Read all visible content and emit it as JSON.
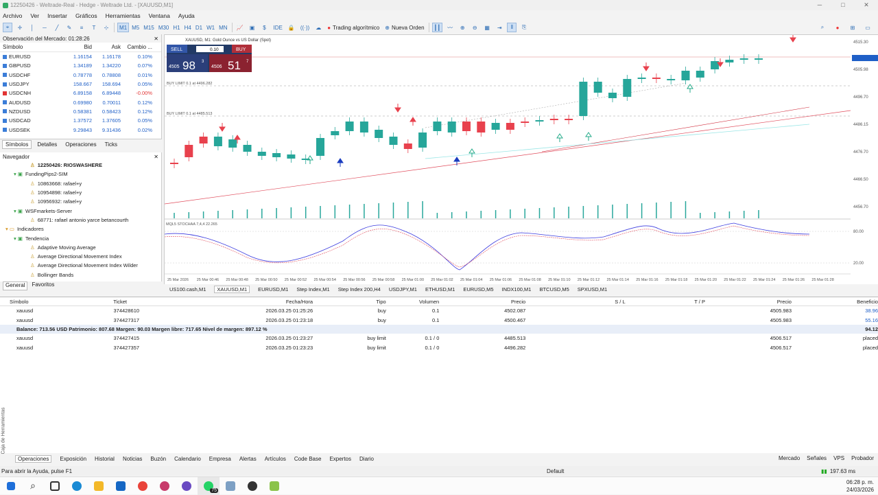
{
  "window": {
    "title": "12250426 - Weltrade-Real - Hedge - Weltrade Ltd. - [XAUUSD,M1]"
  },
  "menu": [
    "Archivo",
    "Ver",
    "Insertar",
    "Gráficos",
    "Herramientas",
    "Ventana",
    "Ayuda"
  ],
  "toolbar": {
    "timeframes": [
      "M1",
      "M5",
      "M15",
      "M30",
      "H1",
      "H4",
      "D1",
      "W1",
      "MN"
    ],
    "algo": "Trading algorítmico",
    "new_order": "Nueva Orden",
    "ide": "IDE"
  },
  "market": {
    "title": "Observación del Mercado: 01:28:26",
    "cols": [
      "Símbolo",
      "Bid",
      "Ask",
      "Cambio ..."
    ],
    "rows": [
      {
        "s": "EURUSD",
        "b": "1.16154",
        "a": "1.16178",
        "c": "0.10%"
      },
      {
        "s": "GBPUSD",
        "b": "1.34189",
        "a": "1.34220",
        "c": "0.07%"
      },
      {
        "s": "USDCHF",
        "b": "0.78778",
        "a": "0.78808",
        "c": "0.01%"
      },
      {
        "s": "USDJPY",
        "b": "158.667",
        "a": "158.694",
        "c": "0.05%"
      },
      {
        "s": "USDCNH",
        "b": "6.89158",
        "a": "6.89448",
        "c": "-0.00%"
      },
      {
        "s": "AUDUSD",
        "b": "0.69980",
        "a": "0.70011",
        "c": "0.12%"
      },
      {
        "s": "NZDUSD",
        "b": "0.58381",
        "a": "0.58423",
        "c": "0.12%"
      },
      {
        "s": "USDCAD",
        "b": "1.37572",
        "a": "1.37605",
        "c": "0.05%"
      },
      {
        "s": "USDSEK",
        "b": "9.29843",
        "a": "9.31436",
        "c": "0.02%"
      }
    ],
    "tabs": [
      "Símbolos",
      "Detalles",
      "Operaciones",
      "Ticks"
    ]
  },
  "navigator": {
    "title": "Navegador",
    "items": [
      {
        "t": "12250426: RIOSWASHERE",
        "lvl": 3,
        "bold": true
      },
      {
        "t": "FundingPips2-SIM",
        "lvl": 1
      },
      {
        "t": "10863668: rafael+y",
        "lvl": 3
      },
      {
        "t": "10954898: rafael+y",
        "lvl": 3
      },
      {
        "t": "10956932: rafael+y",
        "lvl": 3
      },
      {
        "t": "WSFmarkets-Server",
        "lvl": 1
      },
      {
        "t": "68771: rafael antonio yarce betancourth",
        "lvl": 3
      },
      {
        "t": "Indicadores",
        "lvl": 0
      },
      {
        "t": "Tendencia",
        "lvl": 1
      },
      {
        "t": "Adaptive Moving Average",
        "lvl": 3
      },
      {
        "t": "Average Directional Movement Index",
        "lvl": 3
      },
      {
        "t": "Average Directional Movement Index Wilder",
        "lvl": 3
      },
      {
        "t": "Bollinger Bands",
        "lvl": 3
      }
    ],
    "tabs": [
      "General",
      "Favoritos"
    ]
  },
  "chart": {
    "header": "XAUUSD, M1: Gold Ounce vs US Dollar (Spot)",
    "sell": "SELL",
    "buy": "BUY",
    "lot": "0.10",
    "sell_big": "98",
    "sell_pre": "4505",
    "sell_sup": "3",
    "buy_big": "51",
    "buy_pre": "4506",
    "buy_sup": "7",
    "note1": "BUY LIMIT 0.1 at 4496.282",
    "note2": "BUY LIMIT 0.1 at 4485.513",
    "indicator": "MQL5 STOCHAA 7,4,4 22.265",
    "price_labels": [
      "4515.30",
      "4505.98",
      "4496.70",
      "4486.15",
      "4476.70",
      "4466.50",
      "4456.70"
    ],
    "osc_labels": [
      "80.00",
      "20.00"
    ],
    "time_labels": [
      "25 Mar 2026",
      "25 Mar 00:46",
      "25 Mar 00:48",
      "25 Mar 00:50",
      "25 Mar 00:52",
      "25 Mar 00:54",
      "25 Mar 00:56",
      "25 Mar 00:58",
      "25 Mar 01:00",
      "25 Mar 01:02",
      "25 Mar 01:04",
      "25 Mar 01:06",
      "25 Mar 01:08",
      "25 Mar 01:10",
      "25 Mar 01:12",
      "25 Mar 01:14",
      "25 Mar 01:16",
      "25 Mar 01:18",
      "25 Mar 01:20",
      "25 Mar 01:22",
      "25 Mar 01:24",
      "25 Mar 01:26",
      "25 Mar 01:28"
    ]
  },
  "symbol_tabs": [
    "US100.cash,M1",
    "XAUUSD,M1",
    "EURUSD,M1",
    "Step Index,M1",
    "Step Index 200,H4",
    "USDJPY,M1",
    "ETHUSD,M1",
    "EURUSD,M5",
    "INDX100,M1",
    "BTCUSD,M5",
    "SPXUSD,M1"
  ],
  "trade": {
    "cols": [
      "Símbolo",
      "Ticket",
      "Fecha/Hora",
      "Tipo",
      "Volumen",
      "Precio",
      "S / L",
      "T / P",
      "Precio",
      "Beneficio"
    ],
    "positions": [
      {
        "s": "xauusd",
        "t": "374428610",
        "d": "2026.03.25 01:25:26",
        "ty": "buy",
        "v": "0.1",
        "p": "4502.087",
        "cp": "4505.983",
        "pr": "38.96"
      },
      {
        "s": "xauusd",
        "t": "374427317",
        "d": "2026.03.25 01:23:18",
        "ty": "buy",
        "v": "0.1",
        "p": "4500.467",
        "cp": "4505.983",
        "pr": "55.16"
      }
    ],
    "balance": "Balance: 713.56 USD  Patrimonio: 807.68  Margen: 90.03  Margen libre: 717.65  Nivel de margen: 897.12 %",
    "total": "94.12",
    "orders": [
      {
        "s": "xauusd",
        "t": "374427415",
        "d": "2026.03.25 01:23:27",
        "ty": "buy limit",
        "v": "0.1 / 0",
        "p": "4485.513",
        "cp": "4506.517",
        "st": "placed"
      },
      {
        "s": "xauusd",
        "t": "374427357",
        "d": "2026.03.25 01:23:23",
        "ty": "buy limit",
        "v": "0.1 / 0",
        "p": "4496.282",
        "cp": "4506.517",
        "st": "placed"
      }
    ],
    "side_label": "Caja de Herramientas"
  },
  "bottom_tabs": [
    "Operaciones",
    "Exposición",
    "Historial",
    "Noticias",
    "Buzón",
    "Calendario",
    "Empresa",
    "Alertas",
    "Artículos",
    "Code Base",
    "Expertos",
    "Diario"
  ],
  "bottom_right": [
    "Mercado",
    "Señales",
    "VPS",
    "Probador"
  ],
  "status": {
    "left": "Para abrir la Ayuda, pulse F1",
    "mid": "Default",
    "right": "197.63 ms"
  },
  "clock": {
    "time": "06:28 p. m.",
    "date": "24/03/2026"
  },
  "taskbar_badge": "75",
  "colors": {
    "bull": "#26a69a",
    "bear": "#e8414d",
    "accent": "#1f5fc7"
  }
}
